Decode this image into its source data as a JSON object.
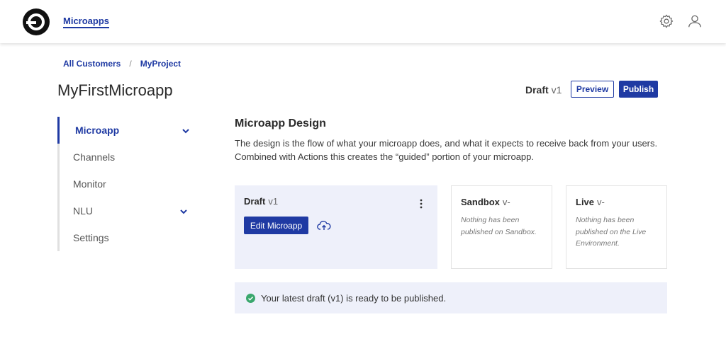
{
  "header": {
    "app_link": "Microapps",
    "icons": [
      "logo-icon",
      "gear-icon",
      "user-icon"
    ]
  },
  "breadcrumb": {
    "items": [
      {
        "label": "All Customers"
      },
      {
        "label": "MyProject"
      }
    ],
    "separator": "/"
  },
  "page": {
    "title": "MyFirstMicroapp",
    "version_status": "Draft",
    "version": "v1",
    "preview_label": "Preview",
    "publish_label": "Publish"
  },
  "sidebar": {
    "items": [
      {
        "label": "Microapp",
        "expandable": true,
        "active": true
      },
      {
        "label": "Channels"
      },
      {
        "label": "Monitor"
      },
      {
        "label": "NLU",
        "expandable": true
      },
      {
        "label": "Settings"
      }
    ]
  },
  "design": {
    "title": "Microapp Design",
    "description": "The design is the flow of what your microapp does, and what it expects to receive back from your users. Combined with Actions this creates the “guided” portion of your microapp."
  },
  "cards": {
    "draft": {
      "title": "Draft",
      "version": "v1",
      "edit_label": "Edit Microapp"
    },
    "sandbox": {
      "title": "Sandbox",
      "version": "v-",
      "note": "Nothing has been published on Sandbox."
    },
    "live": {
      "title": "Live",
      "version": "v-",
      "note": "Nothing has been published on the Live Environment."
    }
  },
  "banner": {
    "text": "Your latest draft (v1) is ready to be published."
  },
  "colors": {
    "accent": "#1f3aa3",
    "panel": "#eef0fa",
    "success": "#3aa76d"
  }
}
